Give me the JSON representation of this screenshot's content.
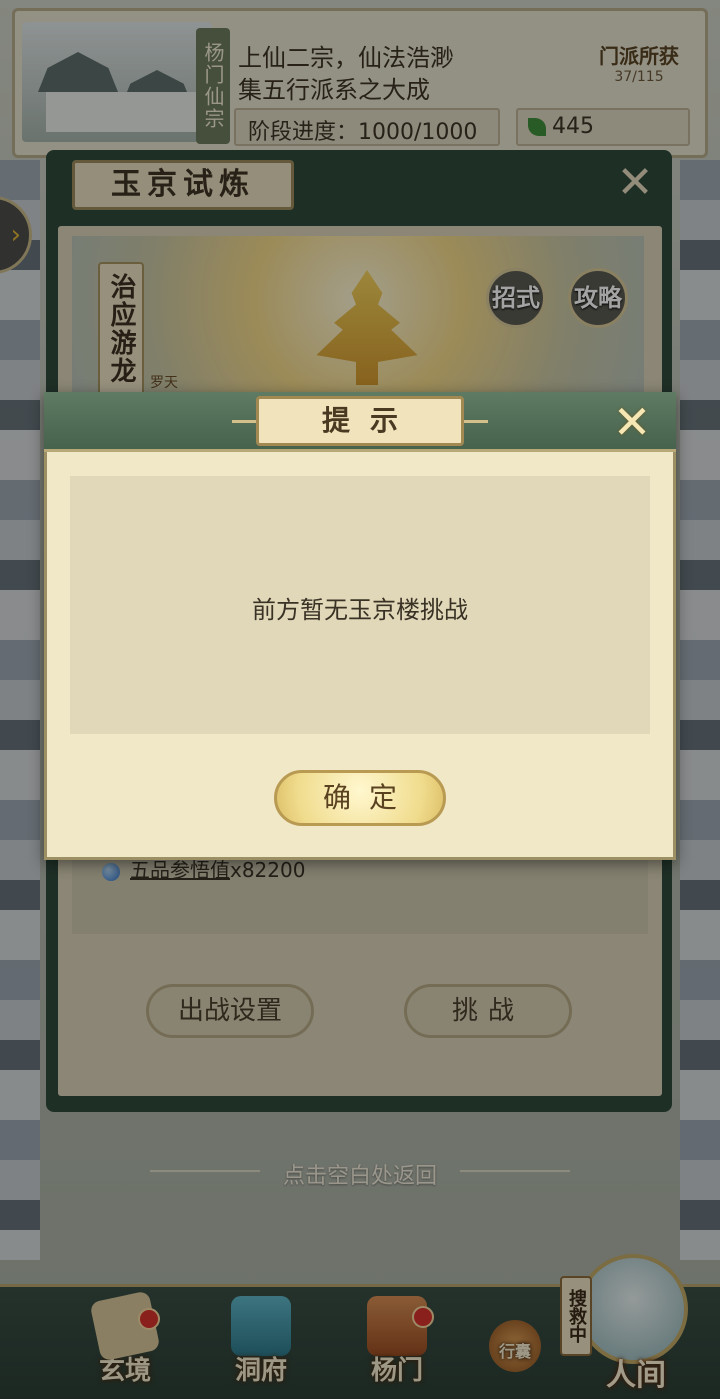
{
  "sect": {
    "name_vertical": "杨门仙宗",
    "desc_line1": "上仙二宗，仙法浩渺",
    "desc_line2": "集五行派系之大成",
    "progress": "阶段进度：1000/1000",
    "currency": "445",
    "reward_label": "门派所获",
    "reward_count": "37/115"
  },
  "trial": {
    "title": "玉京试炼",
    "boss_name": "治应游龙",
    "boss_sub": "罗天",
    "btn_moves": "招式",
    "btn_guide": "攻略",
    "reward_name": "五品参悟值",
    "reward_qty": "x82200",
    "btn_setup": "出战设置",
    "btn_challenge": "挑战"
  },
  "back_hint": "点击空白处返回",
  "nav": {
    "xuanjing": "玄境",
    "dongfu": "洞府",
    "yangmen": "杨门",
    "xingnang": "行囊",
    "search": "搜救中",
    "renjian": "人间"
  },
  "dialog": {
    "title": "提示",
    "message": "前方暂无玉京楼挑战",
    "confirm": "确定"
  },
  "colors": {
    "dialog_bg": "#f1e8c8",
    "header_green": "#5f7b63",
    "button_gold": "#f0dc8d"
  }
}
